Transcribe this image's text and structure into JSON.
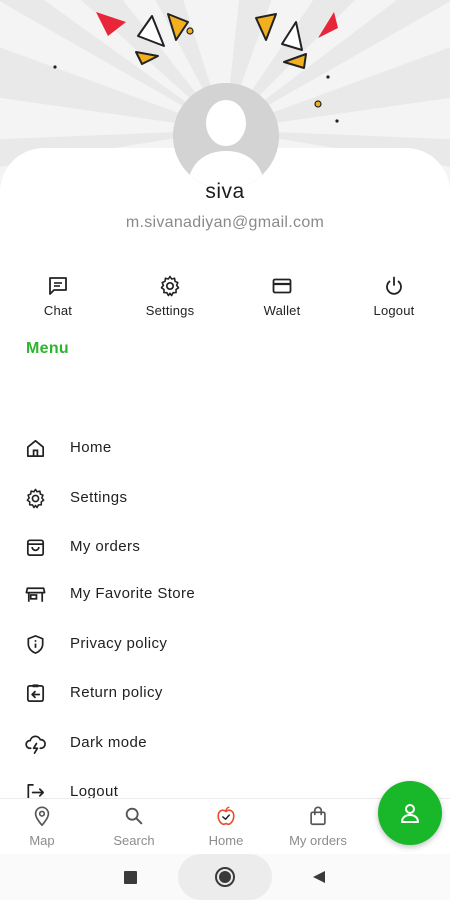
{
  "profile": {
    "name": "siva",
    "email": "m.sivanadiyan@gmail.com"
  },
  "quick_actions": [
    {
      "label": "Chat",
      "icon": "chat-icon"
    },
    {
      "label": "Settings",
      "icon": "gear-icon"
    },
    {
      "label": "Wallet",
      "icon": "wallet-icon"
    },
    {
      "label": "Logout",
      "icon": "power-icon"
    }
  ],
  "menu": {
    "heading": "Menu",
    "items": [
      {
        "label": "Home",
        "icon": "house-icon"
      },
      {
        "label": "Settings",
        "icon": "gear-icon"
      },
      {
        "label": "My orders",
        "icon": "shopping-bag-icon"
      },
      {
        "label": "My Favorite Store",
        "icon": "store-icon"
      },
      {
        "label": "Privacy policy",
        "icon": "shield-info-icon"
      },
      {
        "label": "Return policy",
        "icon": "return-box-icon"
      },
      {
        "label": "Dark mode",
        "icon": "cloud-lightning-icon"
      },
      {
        "label": "Logout",
        "icon": "logout-icon"
      }
    ]
  },
  "bottom_nav": {
    "items": [
      {
        "label": "Map",
        "icon": "map-pin-icon"
      },
      {
        "label": "Search",
        "icon": "search-icon"
      },
      {
        "label": "Home",
        "icon": "apple-home-icon",
        "active": true
      },
      {
        "label": "My orders",
        "icon": "shopping-bag-icon"
      }
    ],
    "fab_icon": "user-icon"
  },
  "system_nav": {
    "buttons": [
      "recents-square-icon",
      "home-circle-icon",
      "back-triangle-icon"
    ]
  },
  "colors": {
    "accent_green": "#2fb42f",
    "fab_green": "#19b72a",
    "confetti_red": "#e8263a",
    "confetti_yellow": "#f2b01e",
    "home_active_orange": "#e8502c"
  }
}
